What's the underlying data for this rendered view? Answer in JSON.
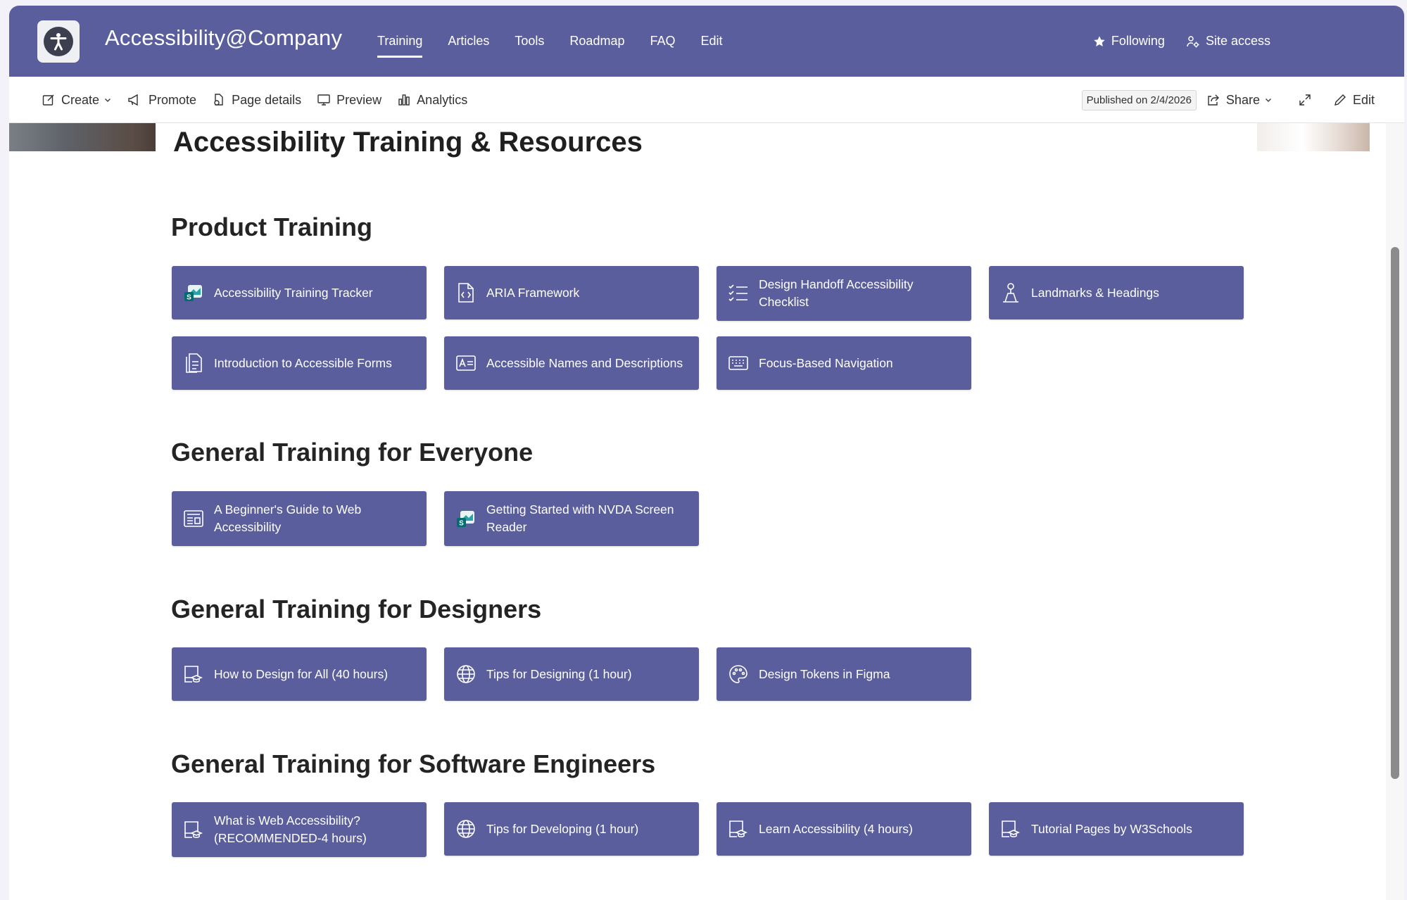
{
  "site": {
    "title": "Accessibility@Company"
  },
  "nav": {
    "items": [
      {
        "label": "Training",
        "active": true
      },
      {
        "label": "Articles"
      },
      {
        "label": "Tools"
      },
      {
        "label": "Roadmap"
      },
      {
        "label": "FAQ"
      },
      {
        "label": "Edit"
      }
    ]
  },
  "header": {
    "following_label": "Following",
    "site_access_label": "Site access"
  },
  "commandbar": {
    "create": "Create",
    "promote": "Promote",
    "page_details": "Page details",
    "preview": "Preview",
    "analytics": "Analytics",
    "published": "Published on 2/4/2026",
    "share": "Share",
    "edit": "Edit"
  },
  "page": {
    "title": "Accessibility Training & Resources"
  },
  "sections": [
    {
      "heading": "Product Training",
      "tiles": [
        {
          "label": "Accessibility Training Tracker",
          "icon": "sharepoint-icon"
        },
        {
          "label": "ARIA Framework",
          "icon": "code-file-icon"
        },
        {
          "label": "Design Handoff Accessibility Checklist",
          "icon": "checklist-icon"
        },
        {
          "label": "Landmarks & Headings",
          "icon": "landmark-icon"
        },
        {
          "label": "Introduction to Accessible Forms",
          "icon": "document-icon"
        },
        {
          "label": "Accessible Names and Descriptions",
          "icon": "text-label-icon"
        },
        {
          "label": "Focus-Based Navigation",
          "icon": "keyboard-icon"
        }
      ]
    },
    {
      "heading": "General Training for Everyone",
      "tiles": [
        {
          "label": "A Beginner's Guide to Web Accessibility",
          "icon": "news-icon"
        },
        {
          "label": "Getting Started with NVDA Screen Reader",
          "icon": "sharepoint-icon"
        }
      ]
    },
    {
      "heading": "General Training for Designers",
      "tiles": [
        {
          "label": "How to Design for All (40 hours)",
          "icon": "book-learning-icon"
        },
        {
          "label": "Tips for Designing (1 hour)",
          "icon": "globe-icon"
        },
        {
          "label": "Design Tokens in Figma",
          "icon": "palette-icon"
        }
      ]
    },
    {
      "heading": "General Training for Software Engineers",
      "tiles": [
        {
          "label": "What is Web Accessibility? (RECOMMENDED-4 hours)",
          "icon": "book-learning-icon"
        },
        {
          "label": "Tips for Developing (1 hour)",
          "icon": "globe-icon"
        },
        {
          "label": "Learn Accessibility (4 hours)",
          "icon": "book-learning-icon"
        },
        {
          "label": "Tutorial Pages by W3Schools",
          "icon": "book-learning-icon"
        }
      ]
    }
  ],
  "colors": {
    "brand": "#5b5e9c",
    "tile": "#5b5e9c",
    "text": "#242424"
  }
}
